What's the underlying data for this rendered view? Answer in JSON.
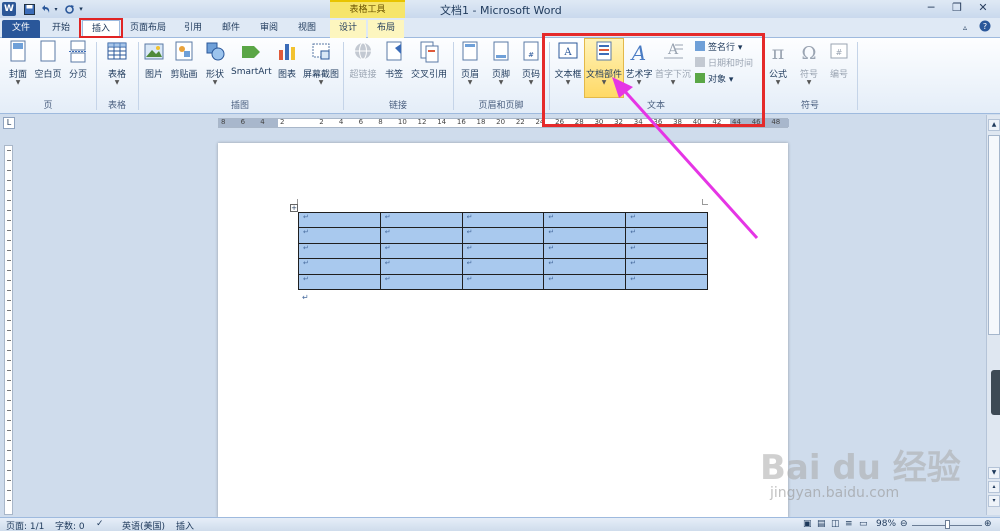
{
  "titlebar": {
    "title": "文档1 - Microsoft Word",
    "context_group": "表格工具",
    "minimize": "─",
    "restore": "❐",
    "close": "✕"
  },
  "tabs": {
    "file": "文件",
    "home": "开始",
    "insert": "插入",
    "layout": "页面布局",
    "references": "引用",
    "mailings": "邮件",
    "review": "审阅",
    "view": "视图",
    "design": "设计",
    "table_layout": "布局"
  },
  "ribbon": {
    "pages": {
      "cover": "封面",
      "blank": "空白页",
      "break": "分页",
      "label": "页"
    },
    "tables": {
      "table": "表格",
      "label": "表格"
    },
    "illustrations": {
      "picture": "图片",
      "clipart": "剪贴画",
      "shapes": "形状",
      "smartart": "SmartArt",
      "chart": "图表",
      "screenshot": "屏幕截图",
      "label": "插图"
    },
    "links": {
      "hyperlink": "超链接",
      "bookmark": "书签",
      "crossref": "交叉引用",
      "label": "链接"
    },
    "header_footer": {
      "header": "页眉",
      "footer": "页脚",
      "page_number": "页码",
      "label": "页眉和页脚"
    },
    "text": {
      "textbox": "文本框",
      "quickparts": "文档部件",
      "wordart": "艺术字",
      "dropcap": "首字下沉",
      "signature": "签名行",
      "datetime": "日期和时间",
      "object": "对象",
      "label": "文本"
    },
    "symbols": {
      "equation": "公式",
      "symbol": "符号",
      "number": "编号",
      "label": "符号"
    }
  },
  "ruler": {
    "numbers": [
      "8",
      "6",
      "4",
      "2",
      "",
      "2",
      "4",
      "6",
      "8",
      "10",
      "12",
      "14",
      "16",
      "18",
      "20",
      "22",
      "24",
      "26",
      "28",
      "30",
      "32",
      "34",
      "36",
      "38",
      "40",
      "42",
      "44",
      "46",
      "48"
    ]
  },
  "statusbar": {
    "page": "页面: 1/1",
    "words": "字数: 0",
    "language": "英语(美国)",
    "mode": "插入",
    "zoom": "98%"
  },
  "watermark": {
    "brand": "Bai du 经验",
    "url": "jingyan.baidu.com"
  },
  "colors": {
    "accent": "#2a579a",
    "highlight": "#e52a2a",
    "arrow": "#e535e5",
    "table_fill": "#a9c9ee"
  }
}
